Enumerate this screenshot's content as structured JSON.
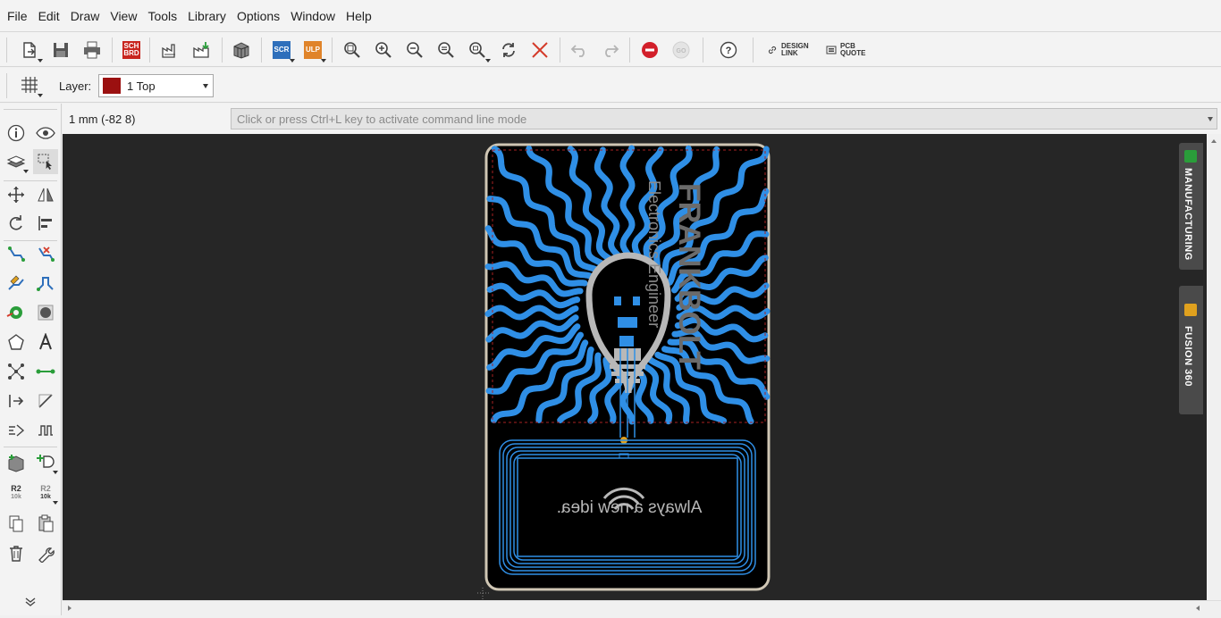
{
  "menu": [
    "File",
    "Edit",
    "Draw",
    "View",
    "Tools",
    "Library",
    "Options",
    "Window",
    "Help"
  ],
  "toolbar": {
    "sch_brd": "SCH BRD",
    "scr": "SCR",
    "ulp": "ULP",
    "go": "GO",
    "help": "?",
    "design_link": "DESIGN LINK",
    "pcb_quote": "PCB QUOTE"
  },
  "layerbar": {
    "label": "Layer:",
    "value": "1 Top",
    "color": "#9b1010"
  },
  "leftpanel": {
    "r2_top": "R2",
    "r2_sub": "10k",
    "r2b_top": "R2",
    "r2b_sub": "10k"
  },
  "coordinate": "1 mm (-82 8)",
  "command_line": {
    "placeholder": "Click or press Ctrl+L key to activate command line mode"
  },
  "side_tabs": {
    "manufacturing": "MANUFACTURING",
    "fusion": "FUSION 360"
  },
  "board": {
    "text_bottom": "Always a new idea.",
    "text_vertical_1": "FRANKBOLT",
    "text_vertical_2": "Electronics Engineer"
  },
  "colors": {
    "canvas_bg": "#262626",
    "board_outline": "#cfc6b4",
    "copper_top": "#2f8fe6",
    "silkscreen": "#b8b8b8"
  }
}
